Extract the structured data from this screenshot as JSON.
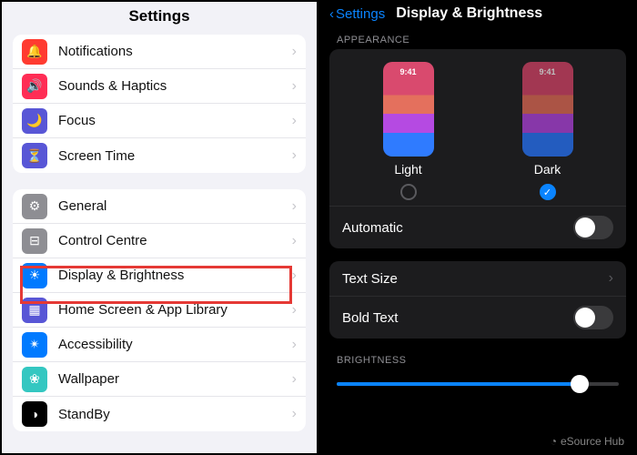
{
  "left": {
    "title": "Settings",
    "group1": [
      {
        "label": "Notifications",
        "icon": "bell-icon",
        "bg": "#ff3b30",
        "glyph": "🔔"
      },
      {
        "label": "Sounds & Haptics",
        "icon": "sounds-icon",
        "bg": "#ff2d55",
        "glyph": "🔊"
      },
      {
        "label": "Focus",
        "icon": "focus-icon",
        "bg": "#5856d6",
        "glyph": "🌙"
      },
      {
        "label": "Screen Time",
        "icon": "screentime-icon",
        "bg": "#5856d6",
        "glyph": "⏳"
      }
    ],
    "group2": [
      {
        "label": "General",
        "icon": "gear-icon",
        "bg": "#8e8e93",
        "glyph": "⚙"
      },
      {
        "label": "Control Centre",
        "icon": "control-icon",
        "bg": "#8e8e93",
        "glyph": "⊟"
      },
      {
        "label": "Display & Brightness",
        "icon": "display-icon",
        "bg": "#007aff",
        "glyph": "☀"
      },
      {
        "label": "Home Screen & App Library",
        "icon": "homescreen-icon",
        "bg": "#5856d6",
        "glyph": "▦"
      },
      {
        "label": "Accessibility",
        "icon": "accessibility-icon",
        "bg": "#007aff",
        "glyph": "✴"
      },
      {
        "label": "Wallpaper",
        "icon": "wallpaper-icon",
        "bg": "#34c7c1",
        "glyph": "❀"
      },
      {
        "label": "StandBy",
        "icon": "standby-icon",
        "bg": "#000000",
        "glyph": "◑"
      }
    ]
  },
  "right": {
    "back_label": "Settings",
    "title": "Display & Brightness",
    "appearance_header": "Appearance",
    "light_label": "Light",
    "dark_label": "Dark",
    "preview_time": "9:41",
    "selected": "dark",
    "automatic_label": "Automatic",
    "automatic_on": false,
    "textsize_label": "Text Size",
    "boldtext_label": "Bold Text",
    "boldtext_on": false,
    "brightness_header": "Brightness"
  },
  "watermark": "eSource Hub"
}
